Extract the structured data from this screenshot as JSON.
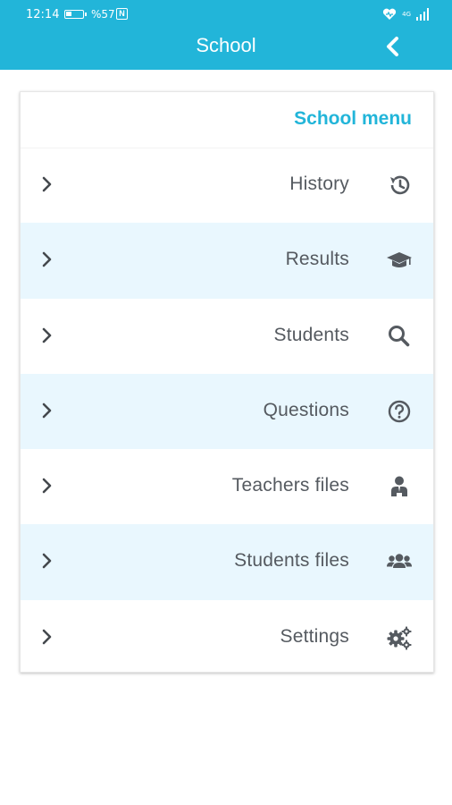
{
  "status_bar": {
    "time": "12:14",
    "battery_percent": "%57",
    "nfc_label": "N",
    "network_label": "4G"
  },
  "header": {
    "title": "School"
  },
  "card": {
    "title": "School menu"
  },
  "menu": {
    "items": [
      {
        "label": "History",
        "icon": "history-icon"
      },
      {
        "label": "Results",
        "icon": "graduation-cap-icon"
      },
      {
        "label": "Students",
        "icon": "search-icon"
      },
      {
        "label": "Questions",
        "icon": "question-circle-icon"
      },
      {
        "label": "Teachers files",
        "icon": "teacher-icon"
      },
      {
        "label": "Students files",
        "icon": "users-icon"
      },
      {
        "label": "Settings",
        "icon": "cogs-icon"
      }
    ]
  },
  "colors": {
    "primary": "#22b5d9",
    "alt_row": "#e9f7fe",
    "label": "#555a60",
    "icon": "#555a60"
  }
}
